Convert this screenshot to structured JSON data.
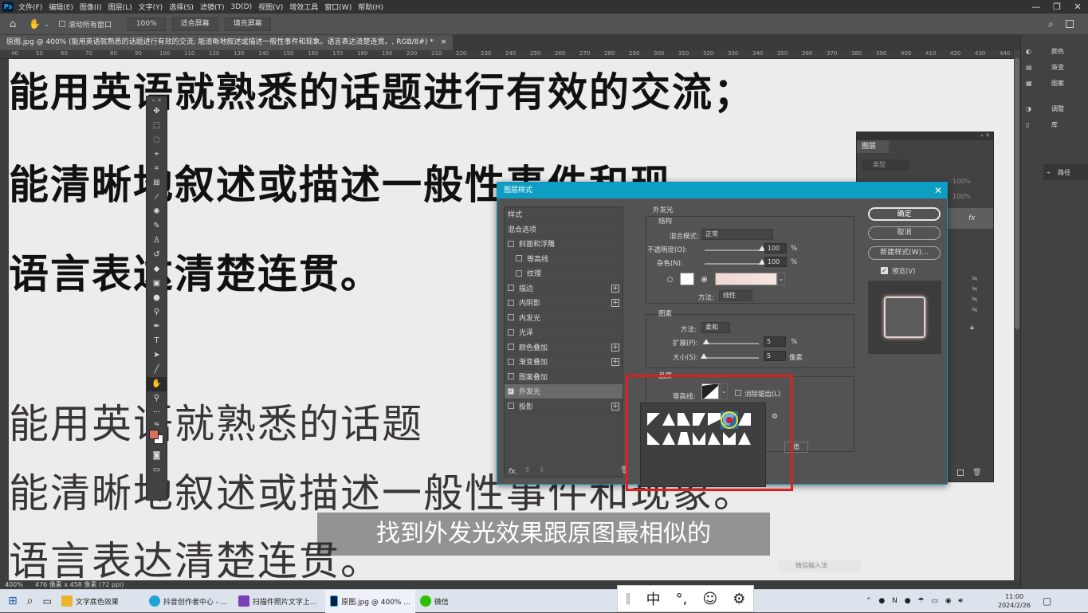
{
  "menubar": {
    "app_icon": "Ps",
    "items": [
      "文件(F)",
      "编辑(E)",
      "图像(I)",
      "图层(L)",
      "文字(Y)",
      "选择(S)",
      "滤镜(T)",
      "3D(D)",
      "视图(V)",
      "增效工具",
      "窗口(W)",
      "帮助(H)"
    ],
    "window_controls": [
      "—",
      "❐",
      "✕"
    ]
  },
  "optbar": {
    "scroll_all": "滚动所有窗口",
    "zoom": "100%",
    "fit": "适合屏幕",
    "fill": "填充屏幕"
  },
  "doc_tab": {
    "title": "原图.jpg @ 400% (能用英语就熟悉的话题进行有效的交流; 能清晰地叙述或描述一般性事件和现象。语言表达清楚连贯。, RGB/8#) *",
    "close": "×"
  },
  "ruler_marks": [
    "40",
    "50",
    "60",
    "70",
    "80",
    "90",
    "100",
    "110",
    "120",
    "130",
    "140",
    "150",
    "160",
    "170",
    "180",
    "190",
    "200",
    "210",
    "220",
    "230",
    "240",
    "250",
    "260",
    "270",
    "280",
    "290",
    "300",
    "310",
    "320",
    "330",
    "340",
    "350",
    "360",
    "370",
    "380",
    "390",
    "400",
    "410",
    "420",
    "430",
    "440"
  ],
  "canvas_text": {
    "line1": "能用英语就熟悉的话题进行有效的交流；",
    "line2": "能清晰地叙述或描述一般性事件和现",
    "line3": "语言表达清楚连贯。",
    "line4": "能用英语就熟悉的话题",
    "line5": "能清晰地叙述或描述一般性事件和现象。",
    "line6": "语言表达清楚连贯。"
  },
  "statusbar": {
    "zoom": "400%",
    "size": "476 像素 x 458 像素 (72 ppi)"
  },
  "right_dock": {
    "items": [
      "颜色",
      "渐变",
      "图案",
      "调整",
      "库",
      "路径"
    ]
  },
  "layers_panel": {
    "title": "图层",
    "kind_placeholder": "类型",
    "opacity": "100%",
    "fill": "100%",
    "fx": "fx"
  },
  "dialog": {
    "title": "图层样式",
    "close": "✕",
    "style_list": [
      {
        "label": "样式",
        "checkbox": false,
        "plus": false,
        "indent": false,
        "checked": false
      },
      {
        "label": "混合选项",
        "checkbox": false,
        "plus": false,
        "indent": false,
        "checked": false
      },
      {
        "label": "斜面和浮雕",
        "checkbox": true,
        "plus": false,
        "indent": false,
        "checked": false
      },
      {
        "label": "等高线",
        "checkbox": true,
        "plus": false,
        "indent": true,
        "checked": false
      },
      {
        "label": "纹理",
        "checkbox": true,
        "plus": false,
        "indent": true,
        "checked": false
      },
      {
        "label": "描边",
        "checkbox": true,
        "plus": true,
        "indent": false,
        "checked": false
      },
      {
        "label": "内阴影",
        "checkbox": true,
        "plus": true,
        "indent": false,
        "checked": false
      },
      {
        "label": "内发光",
        "checkbox": true,
        "plus": false,
        "indent": false,
        "checked": false
      },
      {
        "label": "光泽",
        "checkbox": true,
        "plus": false,
        "indent": false,
        "checked": false
      },
      {
        "label": "颜色叠加",
        "checkbox": true,
        "plus": true,
        "indent": false,
        "checked": false
      },
      {
        "label": "渐变叠加",
        "checkbox": true,
        "plus": true,
        "indent": false,
        "checked": false
      },
      {
        "label": "图案叠加",
        "checkbox": true,
        "plus": false,
        "indent": false,
        "checked": false
      },
      {
        "label": "外发光",
        "checkbox": true,
        "plus": false,
        "indent": false,
        "checked": true
      },
      {
        "label": "投影",
        "checkbox": true,
        "plus": true,
        "indent": false,
        "checked": false
      }
    ],
    "footer_fx": "fx.",
    "section_title": "外发光",
    "structure": {
      "title": "结构",
      "blend_mode_label": "混合模式:",
      "blend_mode": "正常",
      "opacity_label": "不透明度(O):",
      "opacity": "100",
      "opacity_value": 100,
      "noise_label": "杂色(N):",
      "noise": "100",
      "noise_value": 100,
      "unit": "%",
      "method_label": "方法:",
      "method": "线性"
    },
    "elements": {
      "title": "图素",
      "method_label": "方法:",
      "method": "柔和",
      "spread_label": "扩展(P):",
      "spread": "5",
      "spread_value": 5,
      "spread_unit": "%",
      "size_label": "大小(S):",
      "size": "5",
      "size_value": 5,
      "size_unit": "像素"
    },
    "quality": {
      "title": "品质",
      "contour_label": "等高线:",
      "antialias_label": "消除锯齿(L)",
      "reset_partial": "值"
    },
    "buttons": {
      "ok": "确定",
      "cancel": "取消",
      "new_style": "新建样式(W)...",
      "preview": "预览(V)"
    }
  },
  "subtitle": "找到外发光效果跟原图最相似的",
  "weixin_ime": "微信输入法",
  "ime_bar": {
    "chars": [
      "中",
      "°,",
      "☺",
      "⚙"
    ]
  },
  "taskbar": {
    "apps": [
      "文字底色效果",
      "抖音创作者中心 - ...",
      "扫描件照片文字上...",
      "原图.jpg @ 400% ...",
      "微信"
    ],
    "time": "11:00",
    "date": "2024/2/26"
  },
  "colors": {
    "accent": "#0e9ec4",
    "highlight": "#e01e1e",
    "fg_swatch": "#d96f5e",
    "glow_color": "#f1d6d0"
  }
}
